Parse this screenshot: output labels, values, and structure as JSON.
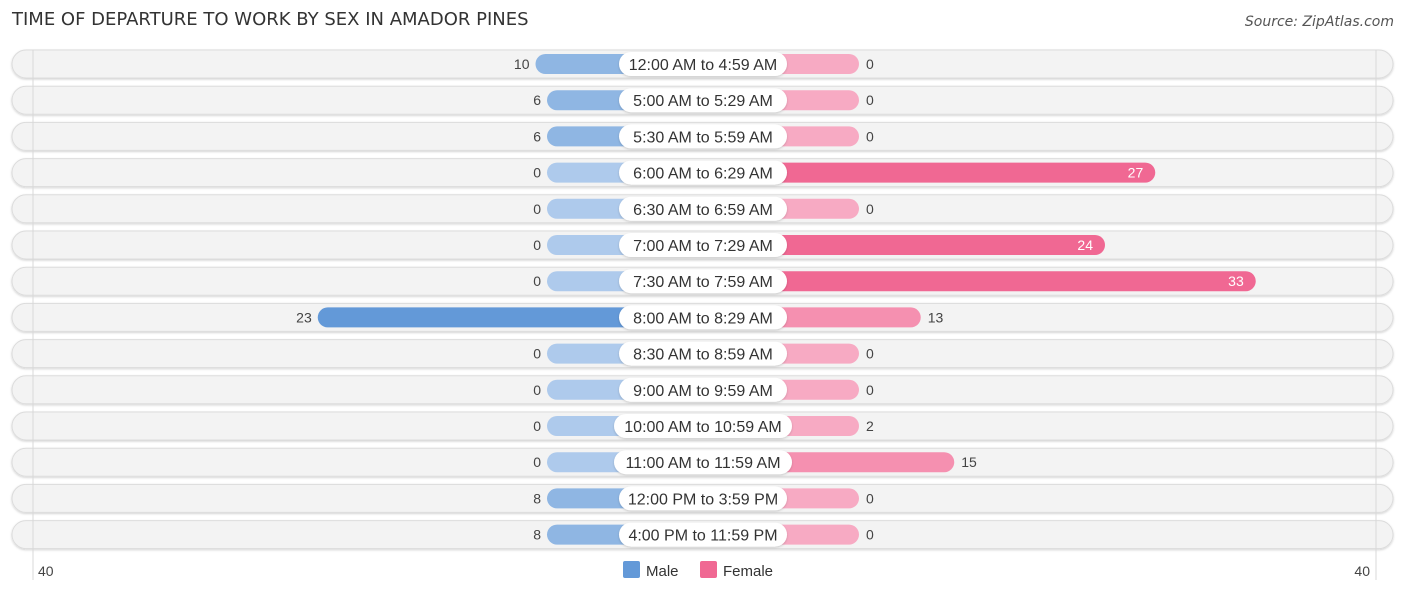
{
  "header": {
    "title": "TIME OF DEPARTURE TO WORK BY SEX IN AMADOR PINES",
    "source": "Source: ZipAtlas.com"
  },
  "colors": {
    "male_dark": "#6399d8",
    "male_mid": "#8fb6e3",
    "male_light": "#aecaec",
    "female_dark": "#f06893",
    "female_mid": "#f590b0",
    "female_light": "#f7aac3",
    "track": "#f3f3f3"
  },
  "chart_data": {
    "type": "bar",
    "orientation": "horizontal-diverging",
    "title": "TIME OF DEPARTURE TO WORK BY SEX IN AMADOR PINES",
    "categories": [
      "12:00 AM to 4:59 AM",
      "5:00 AM to 5:29 AM",
      "5:30 AM to 5:59 AM",
      "6:00 AM to 6:29 AM",
      "6:30 AM to 6:59 AM",
      "7:00 AM to 7:29 AM",
      "7:30 AM to 7:59 AM",
      "8:00 AM to 8:29 AM",
      "8:30 AM to 8:59 AM",
      "9:00 AM to 9:59 AM",
      "10:00 AM to 10:59 AM",
      "11:00 AM to 11:59 AM",
      "12:00 PM to 3:59 PM",
      "4:00 PM to 11:59 PM"
    ],
    "series": [
      {
        "name": "Male",
        "side": "left",
        "values": [
          10,
          6,
          6,
          0,
          0,
          0,
          0,
          23,
          0,
          0,
          0,
          0,
          8,
          8
        ]
      },
      {
        "name": "Female",
        "side": "right",
        "values": [
          0,
          0,
          0,
          27,
          0,
          24,
          33,
          13,
          0,
          0,
          2,
          15,
          0,
          0
        ]
      }
    ],
    "axis": {
      "left_label": "40",
      "right_label": "40",
      "range": [
        -40,
        40
      ]
    },
    "legend": {
      "position": "bottom-center",
      "entries": [
        "Male",
        "Female"
      ]
    },
    "grid": false
  }
}
